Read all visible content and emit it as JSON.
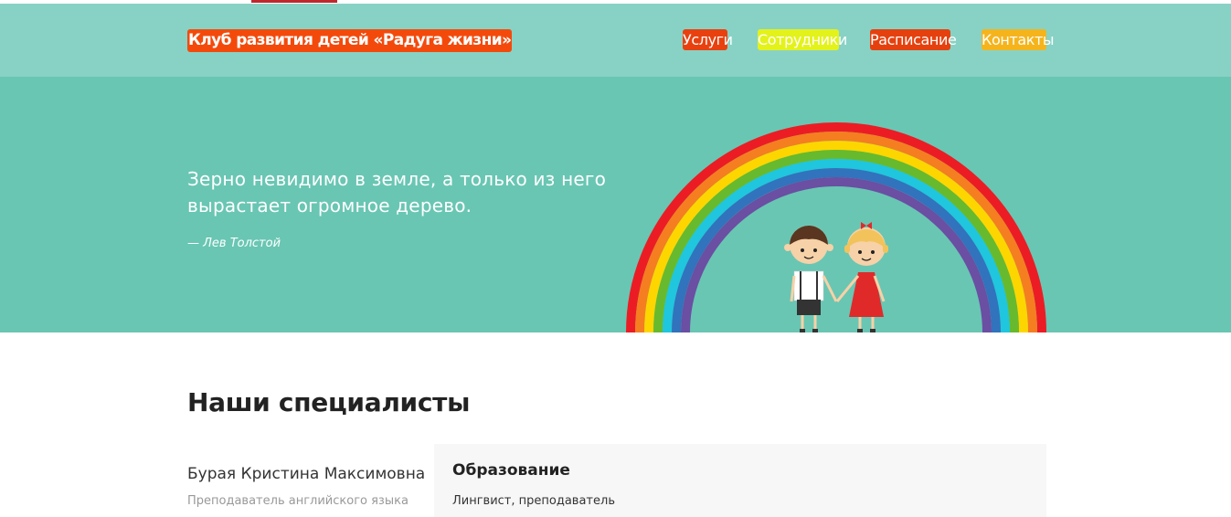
{
  "header": {
    "logo": "Клуб развития детей «Радуга жизни»",
    "nav": [
      {
        "label": "Услуги",
        "color": "#e8410f"
      },
      {
        "label": "Сотрудники",
        "color": "#e3f21a"
      },
      {
        "label": "Расписание",
        "color": "#e5410f"
      },
      {
        "label": "Контакты",
        "color": "#f5b41c"
      }
    ]
  },
  "hero": {
    "quote": "Зерно невидимо в земле, а только из него вырастает огромное дерево.",
    "author": "— Лев Толстой",
    "background": "#69c6b3"
  },
  "main": {
    "section_title": "Наши специалисты",
    "specialist": {
      "name": "Бурая Кристина Максимовна",
      "role": "Преподаватель английского языка",
      "education_title": "Образование",
      "education_text": "Лингвист, преподаватель"
    }
  }
}
